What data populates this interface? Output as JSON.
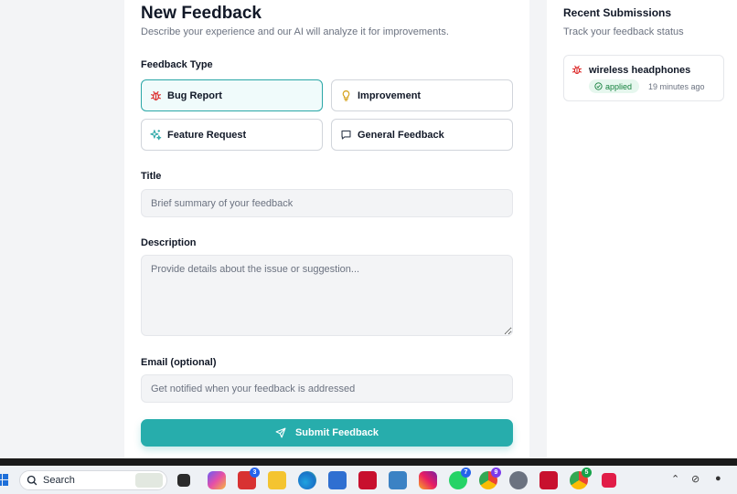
{
  "form": {
    "title": "New Feedback",
    "subtitle": "Describe your experience and our AI will analyze it for improvements.",
    "type_label": "Feedback Type",
    "types": [
      {
        "label": "Bug Report",
        "icon": "bug-icon",
        "selected": true
      },
      {
        "label": "Improvement",
        "icon": "lightbulb-icon",
        "selected": false
      },
      {
        "label": "Feature Request",
        "icon": "sparkles-icon",
        "selected": false
      },
      {
        "label": "General Feedback",
        "icon": "message-square-icon",
        "selected": false
      }
    ],
    "title_label": "Title",
    "title_placeholder": "Brief summary of your feedback",
    "description_label": "Description",
    "description_placeholder": "Provide details about the issue or suggestion...",
    "email_label": "Email (optional)",
    "email_placeholder": "Get notified when your feedback is addressed",
    "submit_label": "Submit Feedback"
  },
  "sidebar": {
    "title": "Recent Submissions",
    "subtitle": "Track your feedback status",
    "submissions": [
      {
        "title": "wireless headphones",
        "status": "applied",
        "time": "19 minutes ago",
        "icon": "bug-icon"
      }
    ]
  },
  "taskbar": {
    "search_label": "Search",
    "badges": {
      "l_app": "3",
      "whatsapp": "7",
      "chrome_a": "9",
      "chrome_b": "5"
    }
  },
  "colors": {
    "accent": "#27adac",
    "bug": "#dc2626",
    "improvement": "#d4a017",
    "feature": "#2aa7a7",
    "success_bg": "#e6f7ee",
    "success_text": "#15803d"
  }
}
